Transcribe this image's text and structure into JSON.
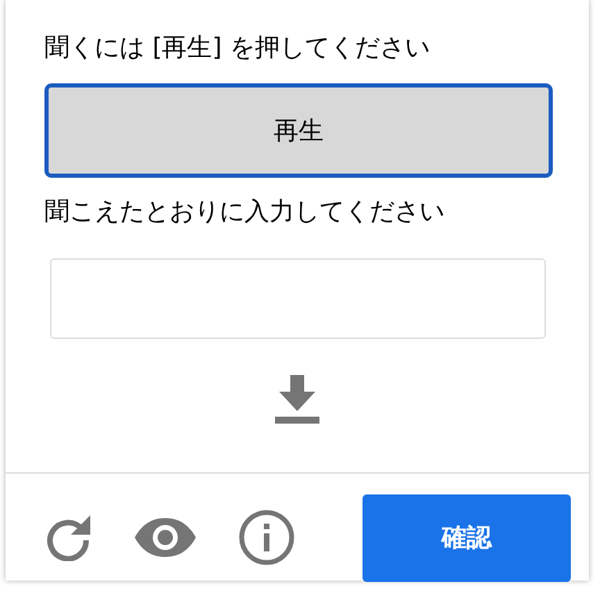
{
  "prompt": "聞くには [再生] を押してください",
  "play_button": "再生",
  "instruction": "聞こえたとおりに入力してください",
  "verify_button": "確認"
}
